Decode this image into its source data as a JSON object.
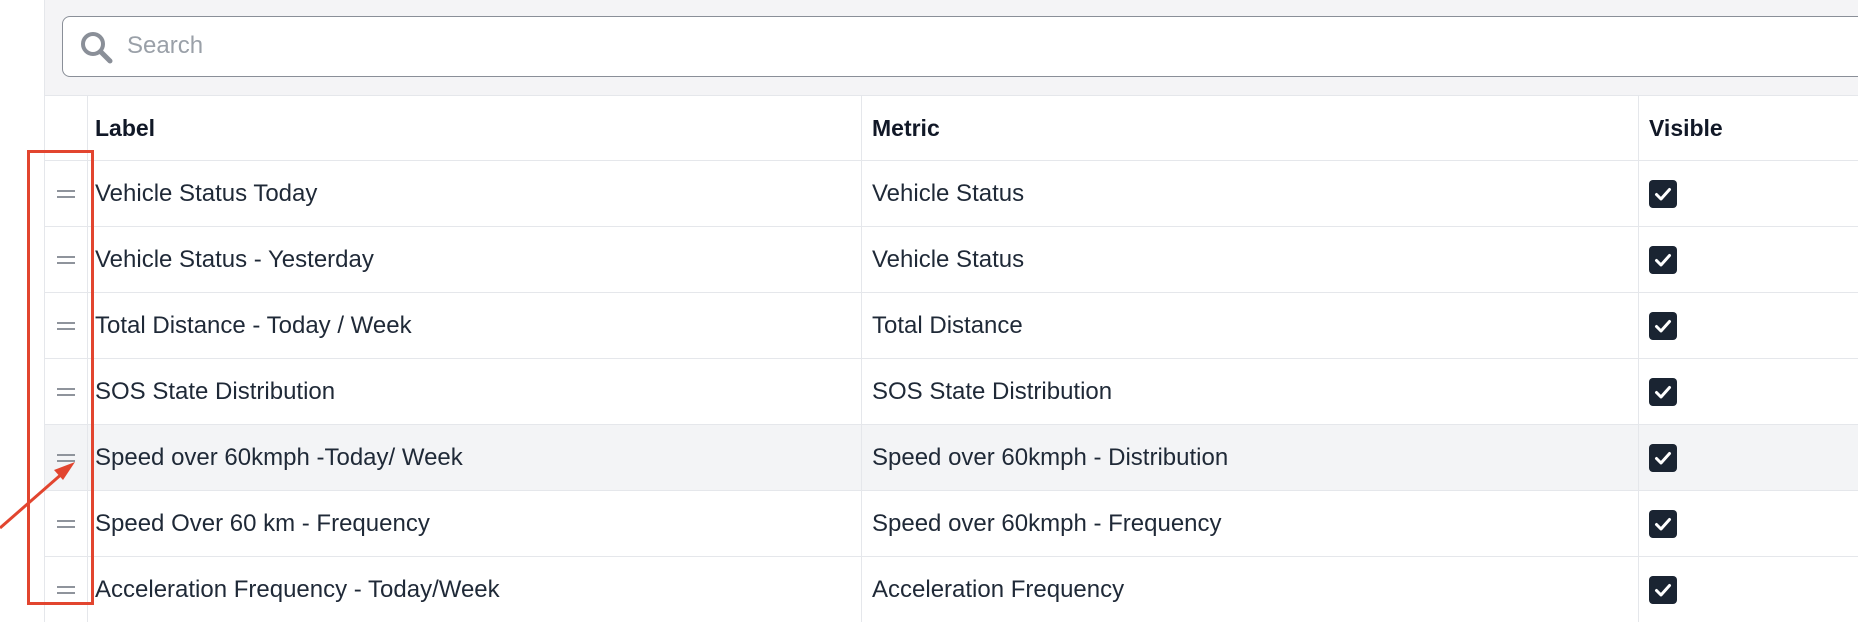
{
  "search": {
    "placeholder": "Search",
    "icon": "search-icon"
  },
  "table": {
    "columns": [
      "Label",
      "Metric",
      "Visible"
    ],
    "rows": [
      {
        "label": "Vehicle Status Today",
        "metric": "Vehicle Status",
        "visible": true
      },
      {
        "label": "Vehicle Status - Yesterday",
        "metric": "Vehicle Status",
        "visible": true
      },
      {
        "label": "Total Distance - Today / Week",
        "metric": "Total Distance",
        "visible": true
      },
      {
        "label": "SOS State Distribution",
        "metric": "SOS State Distribution",
        "visible": true
      },
      {
        "label": "Speed over 60kmph -Today/ Week",
        "metric": "Speed over 60kmph - Distribution",
        "visible": true
      },
      {
        "label": "Speed Over 60 km - Frequency",
        "metric": "Speed over 60kmph - Frequency",
        "visible": true
      },
      {
        "label": "Acceleration Frequency - Today/Week",
        "metric": "Acceleration Frequency",
        "visible": true
      }
    ]
  },
  "colors": {
    "annotation": "#e2452f",
    "checkbox": "#1a2432",
    "row_highlight": "#f3f4f6"
  }
}
